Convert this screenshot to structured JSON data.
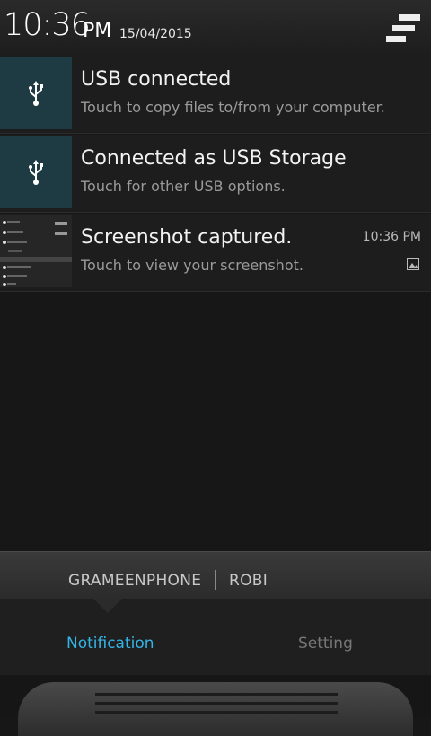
{
  "status": {
    "time": "10:36",
    "ampm": "PM",
    "date": "15/04/2015"
  },
  "notifications": [
    {
      "title": "USB connected",
      "subtitle": "Touch to copy files to/from your computer.",
      "icon": "usb-icon"
    },
    {
      "title": "Connected as USB Storage",
      "subtitle": "Touch for other USB options.",
      "icon": "usb-icon"
    },
    {
      "title": "Screenshot captured.",
      "subtitle": "Touch to view your screenshot.",
      "time": "10:36 PM",
      "icon": "image-icon"
    }
  ],
  "carriers": [
    "GRAMEENPHONE",
    "ROBI"
  ],
  "tabs": {
    "notification": "Notification",
    "setting": "Setting",
    "active": "notification"
  },
  "colors": {
    "accent": "#33b5e5",
    "usb_bg": "#1e3b44"
  }
}
